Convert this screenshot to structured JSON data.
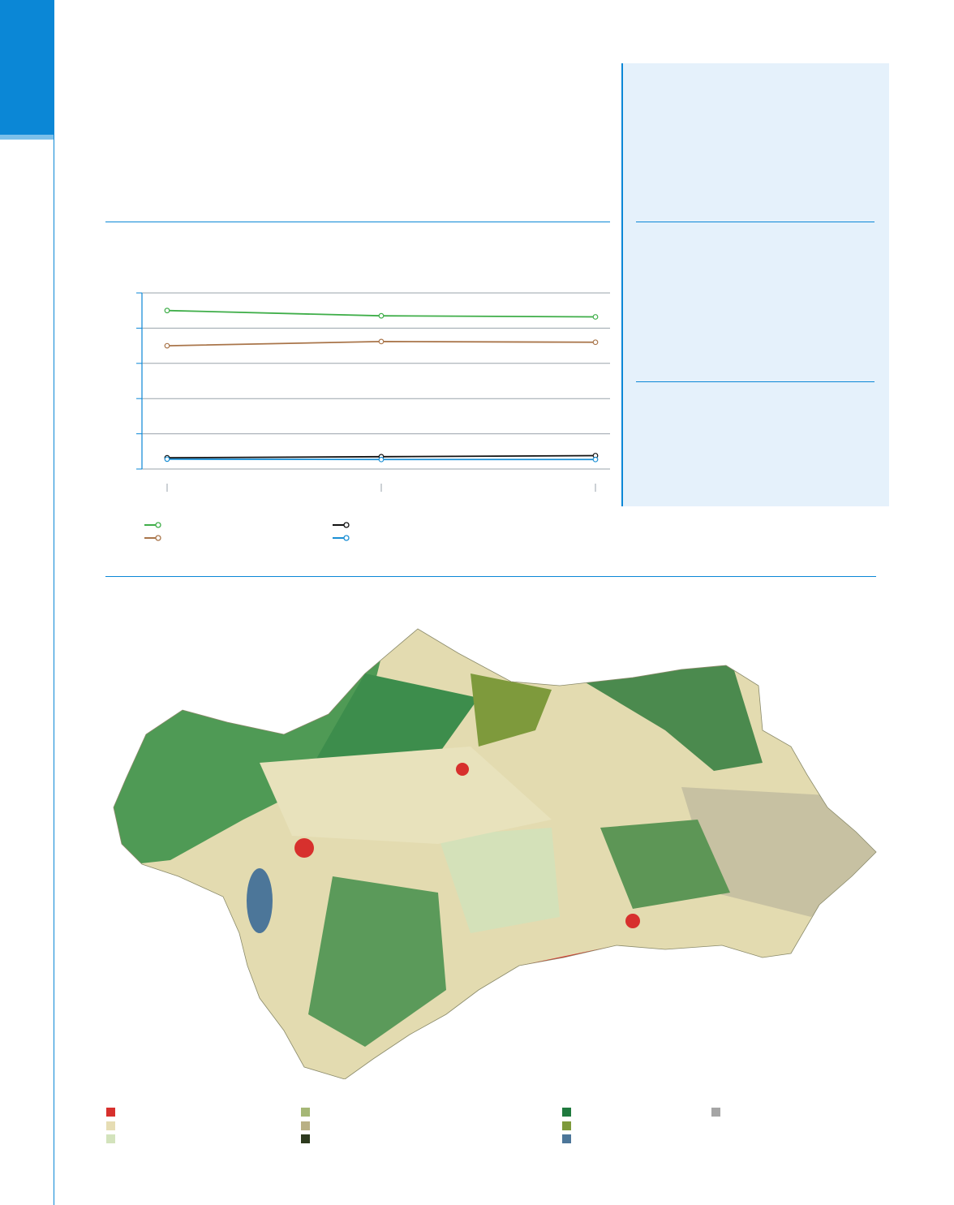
{
  "colors": {
    "accent": "#0b87d6",
    "sidebar_bg": "#e5f1fb"
  },
  "chart_data": {
    "type": "line",
    "x": [
      "",
      "",
      ""
    ],
    "ylim": [
      0,
      5
    ],
    "grid": true,
    "series": [
      {
        "color": "#3fae49",
        "values": [
          4.5,
          4.35,
          4.32
        ]
      },
      {
        "color": "#a9754a",
        "values": [
          3.5,
          3.62,
          3.6
        ]
      },
      {
        "color": "#111111",
        "values": [
          0.32,
          0.35,
          0.38
        ]
      },
      {
        "color": "#1b8fd4",
        "values": [
          0.28,
          0.27,
          0.27
        ]
      }
    ]
  },
  "map": {
    "legend_colors": [
      "#d7302d",
      "#e6ddb4",
      "#d3e3bc",
      "#a5b776",
      "#b9b085",
      "#2d3a1e",
      "#1f7a3e",
      "#7e9a3c",
      "#4c7699",
      "#a5a5a5"
    ]
  }
}
